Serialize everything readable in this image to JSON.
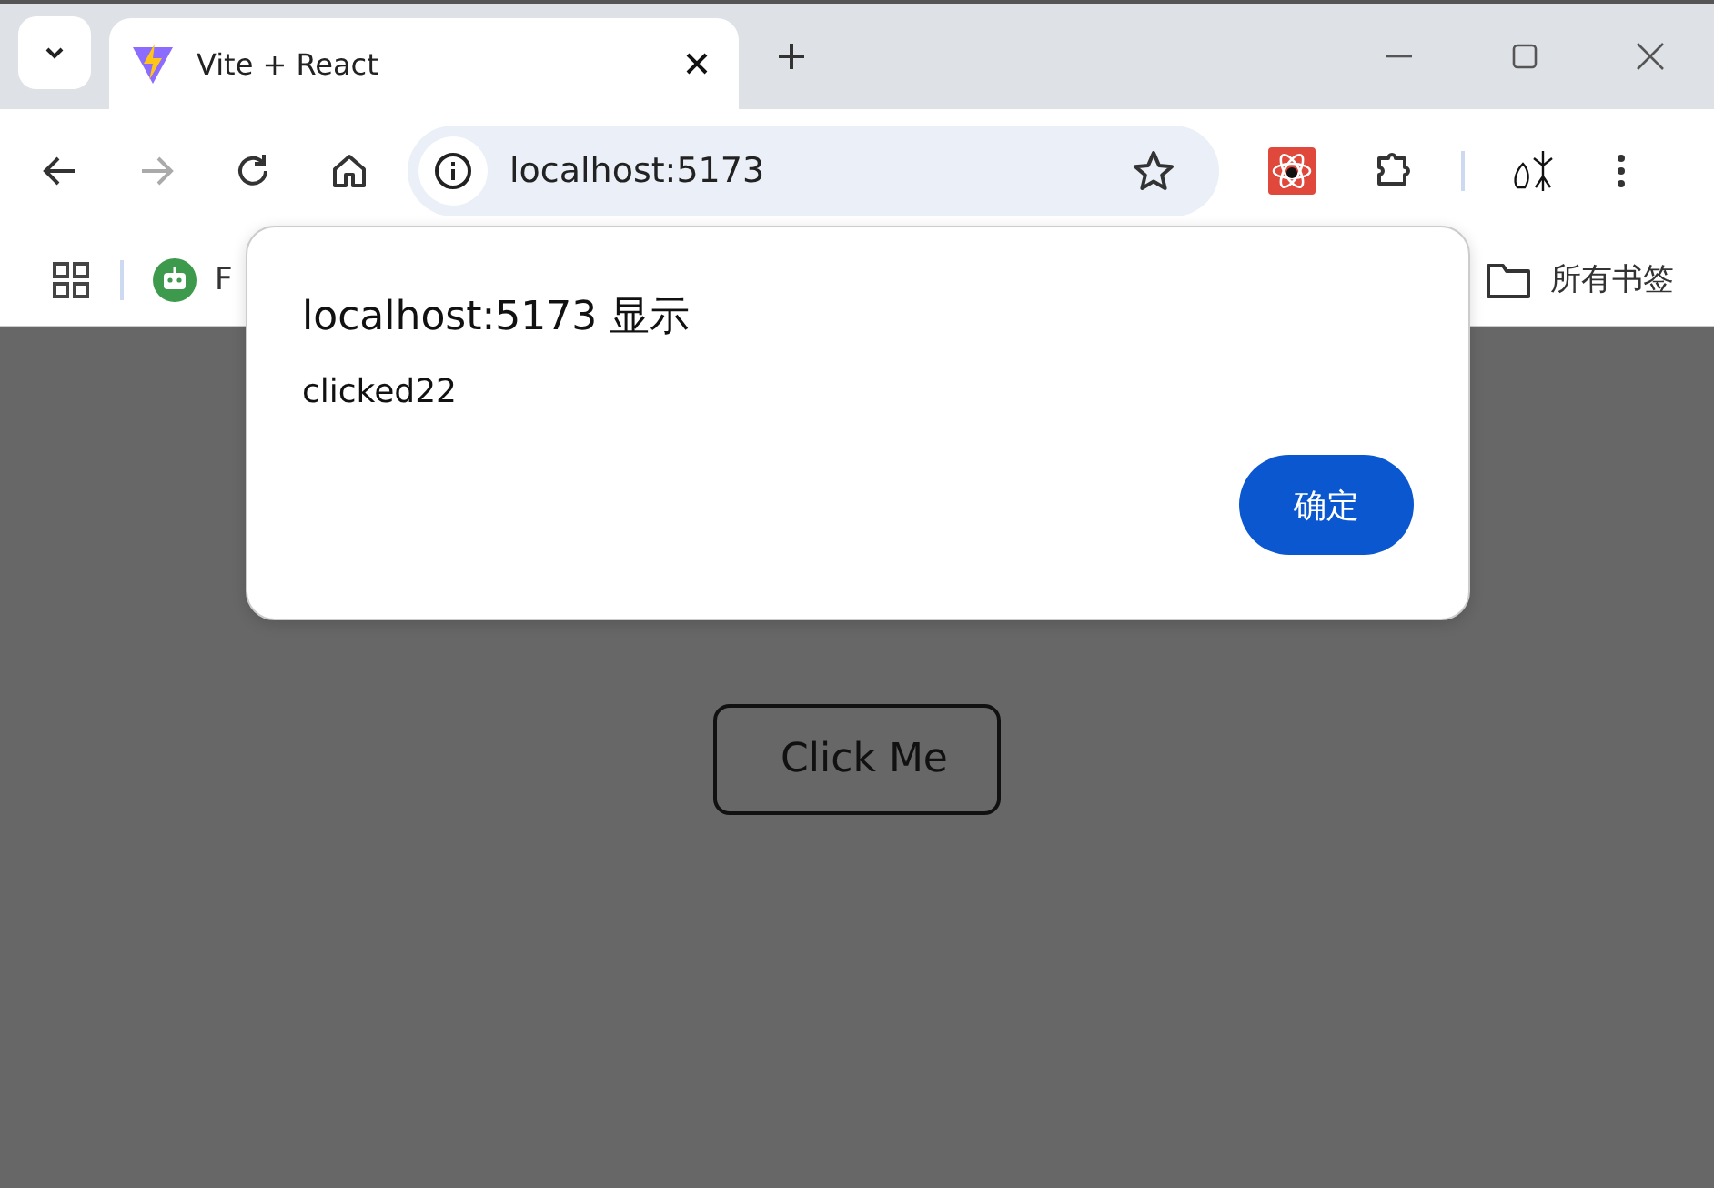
{
  "tab": {
    "title": "Vite + React"
  },
  "address_bar": {
    "value": "localhost:5173"
  },
  "bookmarks_bar": {
    "items": [
      {
        "label": "F"
      }
    ],
    "all_bookmarks": "所有书签"
  },
  "page": {
    "button": "Click Me"
  },
  "dialog": {
    "title": "localhost:5173 显示",
    "message": "clicked22",
    "ok_button": "确定"
  }
}
